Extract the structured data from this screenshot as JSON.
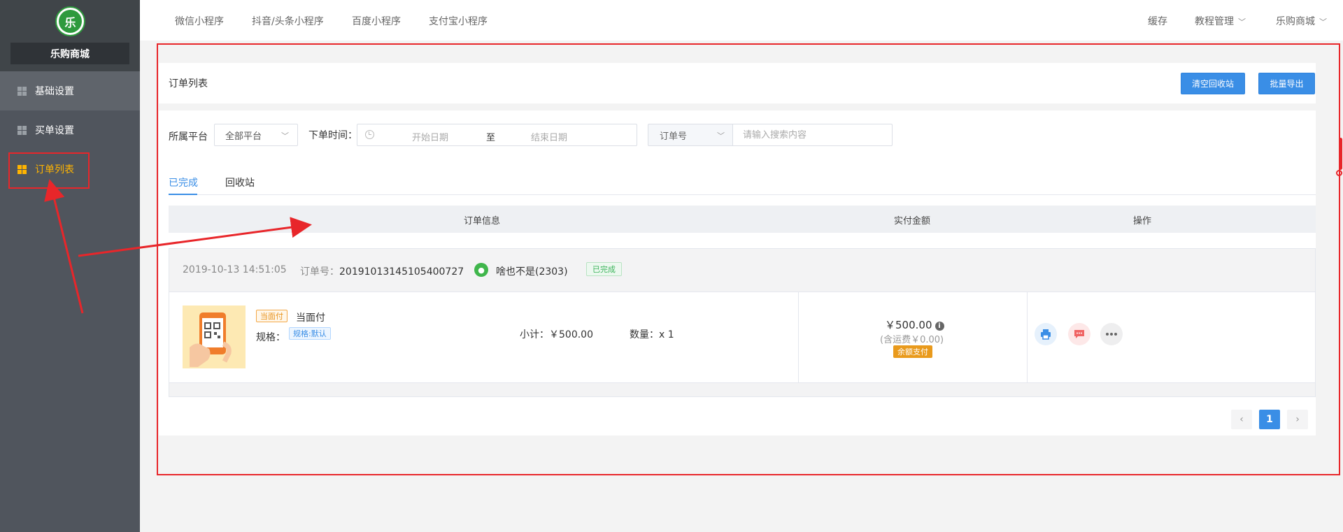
{
  "sidebar": {
    "logo_text": "乐",
    "shop_name": "乐购商城",
    "items": [
      {
        "label": "基础设置"
      },
      {
        "label": "买单设置"
      },
      {
        "label": "订单列表"
      }
    ]
  },
  "topnav": {
    "tabs": [
      "微信小程序",
      "抖音/头条小程序",
      "百度小程序",
      "支付宝小程序"
    ],
    "right": {
      "cache": "缓存",
      "tutorial": "教程管理",
      "shop": "乐购商城"
    }
  },
  "page": {
    "title": "订单列表",
    "btn_clear": "清空回收站",
    "btn_export": "批量导出"
  },
  "filters": {
    "platform_label": "所属平台",
    "platform_value": "全部平台",
    "time_label": "下单时间：",
    "start_placeholder": "开始日期",
    "range_sep": "至",
    "end_placeholder": "结束日期",
    "order_field": "订单号",
    "search_placeholder": "请输入搜索内容"
  },
  "tabs": [
    "已完成",
    "回收站"
  ],
  "table": {
    "headers": [
      "订单信息",
      "实付金额",
      "操作"
    ]
  },
  "order": {
    "time": "2019-10-13 14:51:05",
    "no_label": "订单号：",
    "no": "20191013145105400727",
    "user": "啥也不是(2303)",
    "status": "已完成",
    "product_tag": "当面付",
    "product_name": "当面付",
    "spec_label": "规格：",
    "spec_value": "规格:默认",
    "subtotal": "小计：￥500.00",
    "quantity": "数量：x 1",
    "paid": "￥500.00",
    "freight": "(含运费￥0.00)",
    "pay_method": "余额支付"
  },
  "pagination": {
    "prev": "‹",
    "current": "1",
    "next": "›"
  },
  "colors": {
    "primary": "#3a8ee6",
    "sidebar": "#50555d",
    "highlight": "#ffb400",
    "annotation": "#e8262a"
  }
}
